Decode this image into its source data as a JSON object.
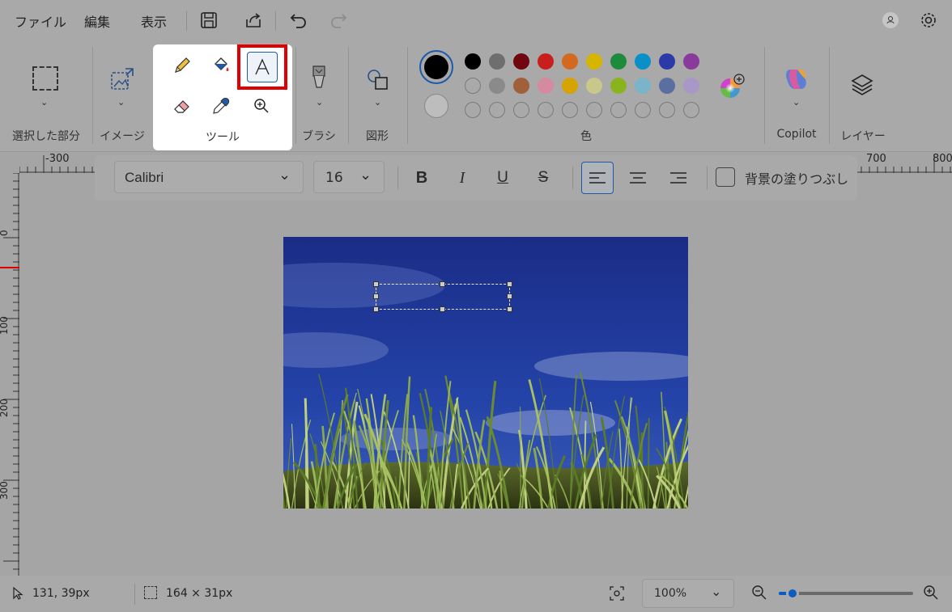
{
  "menu": {
    "file": "ファイル",
    "edit": "編集",
    "view": "表示"
  },
  "ribbon": {
    "selection_label": "選択した部分",
    "image_label": "イメージ",
    "tools_label": "ツール",
    "brush_label": "ブラシ",
    "shapes_label": "図形",
    "colors_label": "色",
    "copilot_label": "Copilot",
    "layers_label": "レイヤー"
  },
  "colors": {
    "primary": "#000000",
    "secondary": "#e6e6e6",
    "palette_row1": [
      "#000000",
      "#6e6e6e",
      "#6f0610",
      "#c81e1e",
      "#d2691e",
      "#d6b500",
      "#1e8a3c",
      "#0a8fc8",
      "#2c3aa8",
      "#8a3a9a"
    ],
    "palette_row2": [
      "",
      "#8a8a8a",
      "#a0603a",
      "#d68aa0",
      "#d6a300",
      "#c8c88a",
      "#8ab41e",
      "#7ab4c8",
      "#5a6ea0",
      "#a898c8"
    ],
    "palette_row3": [
      "",
      "",
      "",
      "",
      "",
      "",
      "",
      "",
      "",
      ""
    ],
    "highlight": "#e00000",
    "accent": "#0a5cc2"
  },
  "text_toolbar": {
    "font": "Calibri",
    "size": "16",
    "fill_background_label": "背景の塗りつぶし"
  },
  "rulers": {
    "top_ticks": [
      "-300",
      "700",
      "800"
    ],
    "left_ticks": [
      "0",
      "100",
      "200",
      "300"
    ]
  },
  "status": {
    "cursor_pos": "131, 39px",
    "selection_size": "164 × 31px",
    "zoom": "100%",
    "zoom_slider_fraction": 0.1
  },
  "icons": [
    "save-icon",
    "share-icon",
    "undo-icon",
    "redo-icon",
    "account-icon",
    "settings-icon",
    "pencil-icon",
    "fill-icon",
    "text-icon",
    "eraser-icon",
    "color-picker-icon",
    "magnifier-icon"
  ]
}
